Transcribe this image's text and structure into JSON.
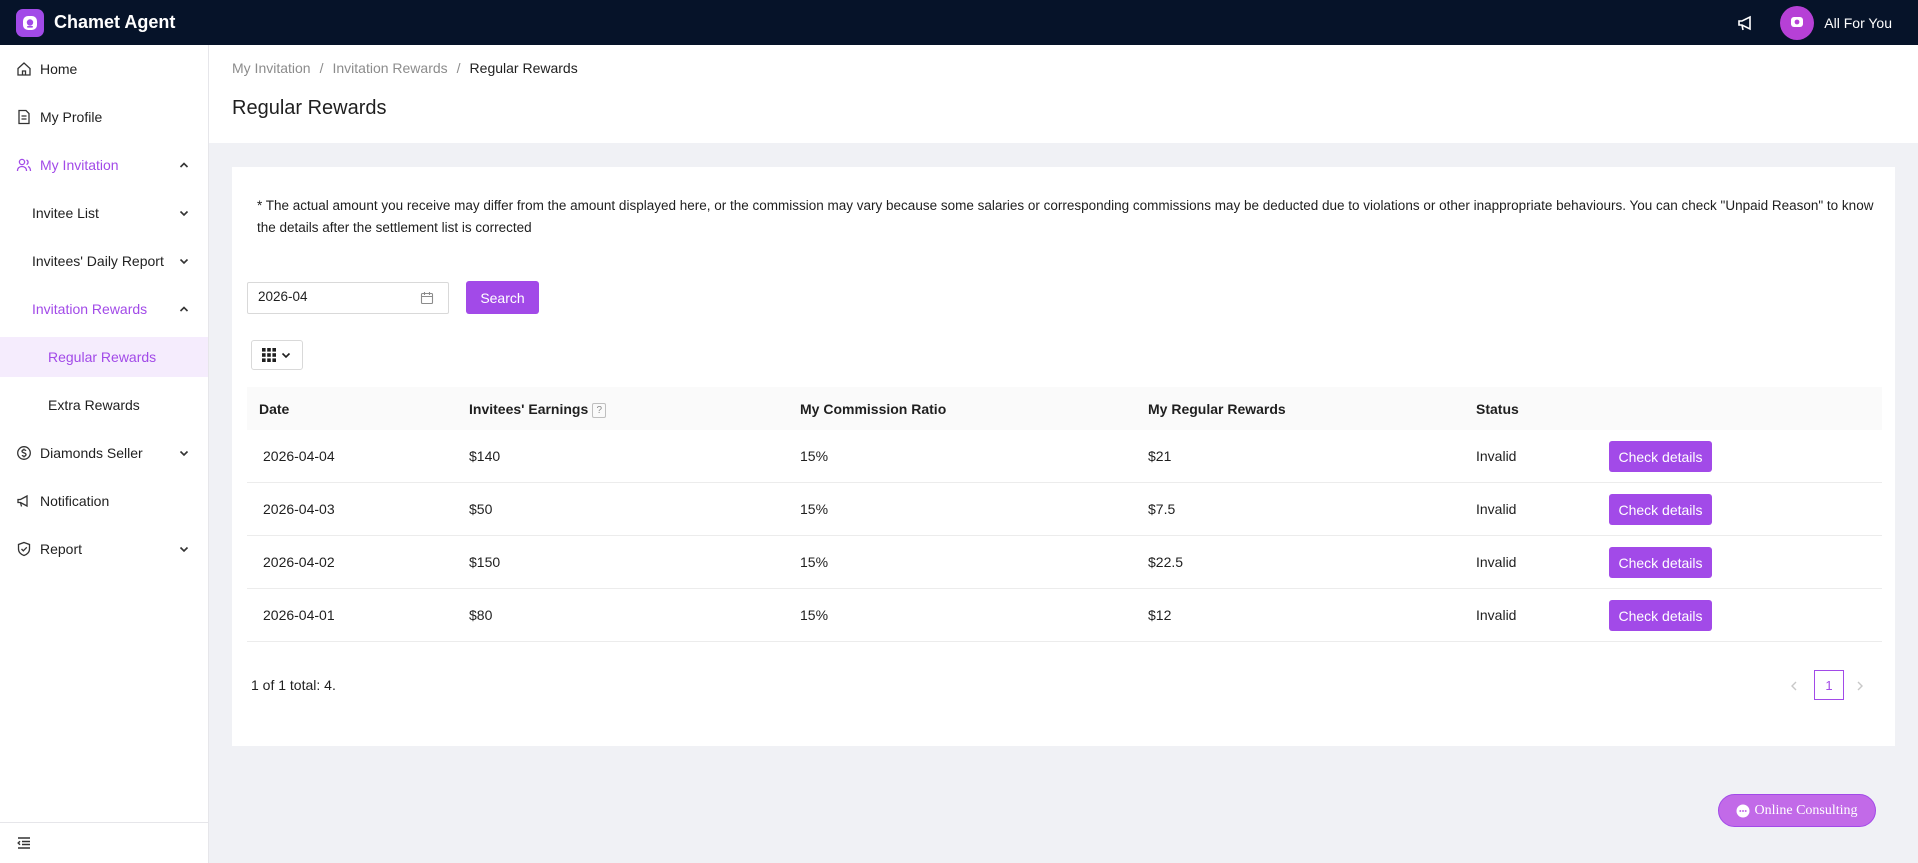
{
  "app": {
    "title": "Chamet Agent",
    "logo_icon": "app-logo-icon",
    "accent_color": "#a24ae8",
    "topbar_color": "#061329"
  },
  "header": {
    "notification_icon": "megaphone-icon",
    "username": "All For You"
  },
  "sidebar": {
    "items": [
      {
        "label": "Home",
        "icon": "home-icon"
      },
      {
        "label": "My Profile",
        "icon": "profile-doc-icon"
      },
      {
        "label": "My Invitation",
        "icon": "users-icon",
        "expanded": true
      },
      {
        "label": "Invitee List"
      },
      {
        "label": "Invitees' Daily Report"
      },
      {
        "label": "Invitation Rewards",
        "expanded": true
      },
      {
        "label": "Regular Rewards",
        "selected": true
      },
      {
        "label": "Extra Rewards"
      },
      {
        "label": "Diamonds Seller",
        "icon": "dollar-circle-icon"
      },
      {
        "label": "Notification",
        "icon": "megaphone-icon"
      },
      {
        "label": "Report",
        "icon": "shield-check-icon"
      }
    ],
    "collapse_icon": "menu-collapse-icon"
  },
  "breadcrumb": [
    "My Invitation",
    "Invitation Rewards",
    "Regular Rewards"
  ],
  "page_title": "Regular Rewards",
  "notice": "* The actual amount you receive may differ from the amount displayed here, or the commission may vary because some salaries or corresponding commissions may be deducted due to violations or other inappropriate behaviours. You can check \"Unpaid Reason\" to know the details after the settlement list is corrected",
  "filter": {
    "month_value": "2026-04",
    "search_label": "Search"
  },
  "table": {
    "columns": [
      "Date",
      "Invitees' Earnings",
      "My Commission Ratio",
      "My Regular Rewards",
      "Status"
    ],
    "help_mark": "?",
    "rows": [
      {
        "date": "2026-04-04",
        "earnings": "$140",
        "ratio": "15%",
        "rewards": "$21",
        "status": "Invalid",
        "action": "Check details"
      },
      {
        "date": "2026-04-03",
        "earnings": "$50",
        "ratio": "15%",
        "rewards": "$7.5",
        "status": "Invalid",
        "action": "Check details"
      },
      {
        "date": "2026-04-02",
        "earnings": "$150",
        "ratio": "15%",
        "rewards": "$22.5",
        "status": "Invalid",
        "action": "Check details"
      },
      {
        "date": "2026-04-01",
        "earnings": "$80",
        "ratio": "15%",
        "rewards": "$12",
        "status": "Invalid",
        "action": "Check details"
      }
    ]
  },
  "pagination": {
    "summary": "1 of 1 total: 4.",
    "current_page": "1"
  },
  "consult": {
    "label": "Online Consulting"
  }
}
